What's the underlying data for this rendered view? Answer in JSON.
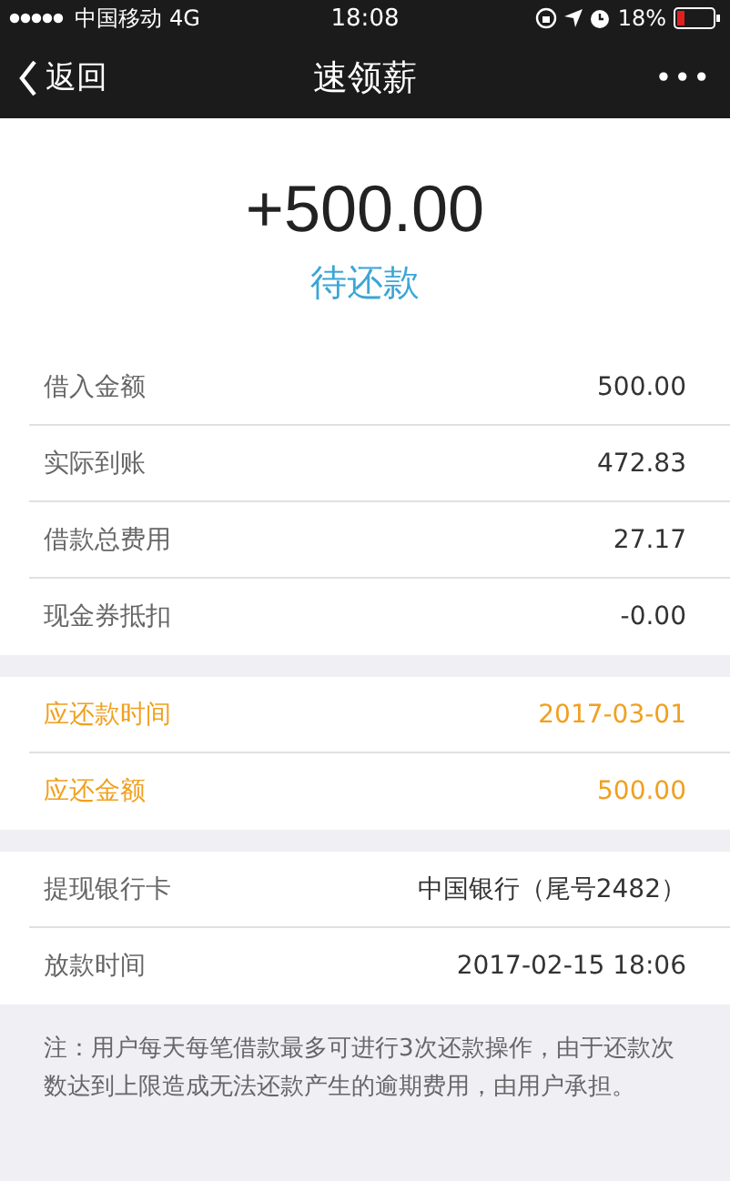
{
  "status_bar": {
    "carrier": "中国移动",
    "network": "4G",
    "time": "18:08",
    "battery_percent": "18%"
  },
  "nav": {
    "back": "返回",
    "title": "速领薪",
    "more": "•••"
  },
  "summary": {
    "amount": "+500.00",
    "status": "待还款"
  },
  "groups": [
    {
      "rows": [
        {
          "kind": "normal",
          "label": "借入金额",
          "value": "500.00"
        },
        {
          "kind": "normal",
          "label": "实际到账",
          "value": "472.83"
        },
        {
          "kind": "normal",
          "label": "借款总费用",
          "value": "27.17"
        },
        {
          "kind": "normal",
          "label": "现金券抵扣",
          "value": "-0.00"
        }
      ]
    },
    {
      "rows": [
        {
          "kind": "due",
          "label": "应还款时间",
          "value": "2017-03-01"
        },
        {
          "kind": "due",
          "label": "应还金额",
          "value": "500.00"
        }
      ]
    },
    {
      "rows": [
        {
          "kind": "normal",
          "label": "提现银行卡",
          "value": "中国银行（尾号2482）"
        },
        {
          "kind": "normal",
          "label": "放款时间",
          "value": "2017-02-15 18:06"
        }
      ]
    }
  ],
  "note": "注：用户每天每笔借款最多可进行3次还款操作，由于还款次数达到上限造成无法还款产生的逾期费用，由用户承担。"
}
